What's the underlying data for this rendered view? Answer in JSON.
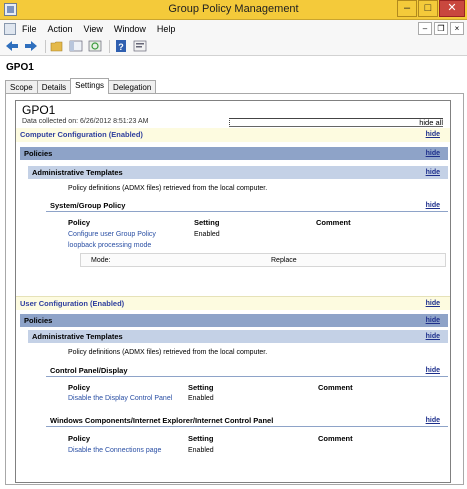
{
  "window": {
    "title": "Group Policy Management",
    "controls": {
      "minimize": "–",
      "maximize": "□",
      "close": "✕"
    }
  },
  "menu": {
    "items": [
      "File",
      "Action",
      "View",
      "Window",
      "Help"
    ],
    "mdi": {
      "minimize": "–",
      "restore": "❐",
      "close": "×"
    }
  },
  "gpo_name": "GPO1",
  "tabs": [
    "Scope",
    "Details",
    "Settings",
    "Delegation"
  ],
  "active_tab": "Settings",
  "report": {
    "title": "GPO1",
    "collected": "Data collected on: 6/26/2012 8:51:23 AM",
    "hide_all": "hide all",
    "hide": "hide",
    "computer": {
      "header": "Computer Configuration (Enabled)",
      "policies": "Policies",
      "admin_templates": "Administrative Templates",
      "definitions_note": "Policy definitions (ADMX files) retrieved from the local computer.",
      "section": "System/Group Policy",
      "col_policy": "Policy",
      "col_setting": "Setting",
      "col_comment": "Comment",
      "row_policy_line1": "Configure user Group Policy",
      "row_policy_line2": "loopback processing mode",
      "row_setting": "Enabled",
      "mode_label": "Mode:",
      "mode_value": "Replace"
    },
    "user": {
      "header": "User Configuration (Enabled)",
      "policies": "Policies",
      "admin_templates": "Administrative Templates",
      "definitions_note": "Policy definitions (ADMX files) retrieved from the local computer.",
      "section1": "Control Panel/Display",
      "s1_policy": "Disable the Display Control Panel",
      "s1_setting": "Enabled",
      "section2": "Windows Components/Internet Explorer/Internet Control Panel",
      "s2_policy": "Disable the Connections page",
      "s2_setting": "Enabled",
      "col_policy": "Policy",
      "col_setting": "Setting",
      "col_comment": "Comment"
    }
  }
}
